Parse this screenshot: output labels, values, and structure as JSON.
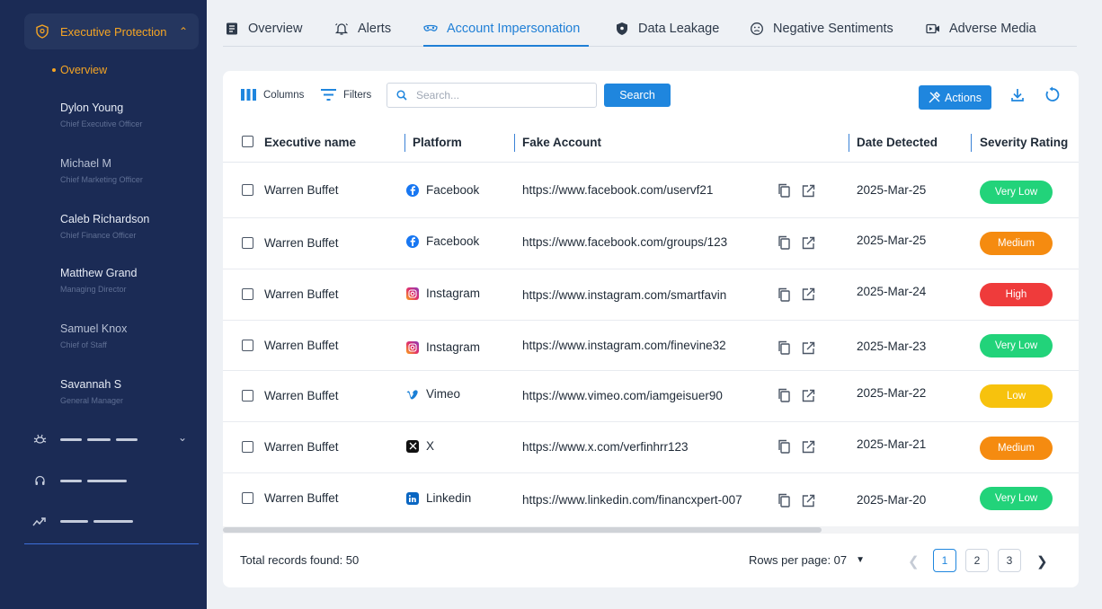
{
  "sidebar": {
    "section_label": "Executive Protection",
    "overview_label": "Overview",
    "people": [
      {
        "name": "Dylon Young",
        "role": "Chief Executive Officer"
      },
      {
        "name": "Michael M",
        "role": "Chief Marketing Officer"
      },
      {
        "name": "Caleb Richardson",
        "role": "Chief Finance Officer"
      },
      {
        "name": "Matthew Grand",
        "role": "Managing Director"
      },
      {
        "name": "Samuel Knox",
        "role": "Chief of Staff"
      },
      {
        "name": "Savannah S",
        "role": "General Manager"
      }
    ],
    "nav_icons": [
      "bug-icon",
      "headset-icon",
      "trend-icon"
    ]
  },
  "tabs": [
    {
      "label": "Overview",
      "icon": "document-icon"
    },
    {
      "label": "Alerts",
      "icon": "bell-icon"
    },
    {
      "label": "Account Impersonation",
      "icon": "mask-icon"
    },
    {
      "label": "Data Leakage",
      "icon": "shield-icon"
    },
    {
      "label": "Negative Sentiments",
      "icon": "sad-face-icon"
    },
    {
      "label": "Adverse Media",
      "icon": "video-icon"
    }
  ],
  "toolbar": {
    "columns_label": "Columns",
    "filters_label": "Filters",
    "search_placeholder": "Search...",
    "search_button": "Search",
    "actions_button": "Actions"
  },
  "table": {
    "headers": [
      "Executive name",
      "Platform",
      "Fake Account",
      "Date Detected",
      "Severity Rating"
    ],
    "rows": [
      {
        "name": "Warren Buffet",
        "platform": "Facebook",
        "account": "https://www.facebook.com/uservf21",
        "date": "2025-Mar-25",
        "severity": "Very Low"
      },
      {
        "name": "Warren Buffet",
        "platform": "Facebook",
        "account": "https://www.facebook.com/groups/123",
        "date": "2025-Mar-25",
        "severity": "Medium"
      },
      {
        "name": "Warren Buffet",
        "platform": "Instagram",
        "account": "https://www.instagram.com/smartfavin",
        "date": "2025-Mar-24",
        "severity": "High"
      },
      {
        "name": "Warren Buffet",
        "platform": "Instagram",
        "account": "https://www.instagram.com/finevine32",
        "date": "2025-Mar-23",
        "severity": "Very Low"
      },
      {
        "name": "Warren Buffet",
        "platform": "Vimeo",
        "account": "https://www.vimeo.com/iamgeisuer90",
        "date": "2025-Mar-22",
        "severity": "Low"
      },
      {
        "name": "Warren Buffet",
        "platform": "X",
        "account": "https://www.x.com/verfinhrr123",
        "date": "2025-Mar-21",
        "severity": "Medium"
      },
      {
        "name": "Warren Buffet",
        "platform": "Linkedin",
        "account": "https://www.linkedin.com/financxpert-007",
        "date": "2025-Mar-20",
        "severity": "Very Low"
      }
    ]
  },
  "footer": {
    "total_records": "Total records found: 50",
    "rows_per_page": "Rows per page: 07",
    "pages": [
      "1",
      "2",
      "3"
    ],
    "current_page": "1"
  },
  "colors": {
    "sidebar_bg": "#1b2b55",
    "accent": "#1f86de",
    "highlight": "#f5a524",
    "very_low": "#22d37a",
    "low": "#f7c20d",
    "medium": "#f58b10",
    "high": "#ef3b3b"
  }
}
